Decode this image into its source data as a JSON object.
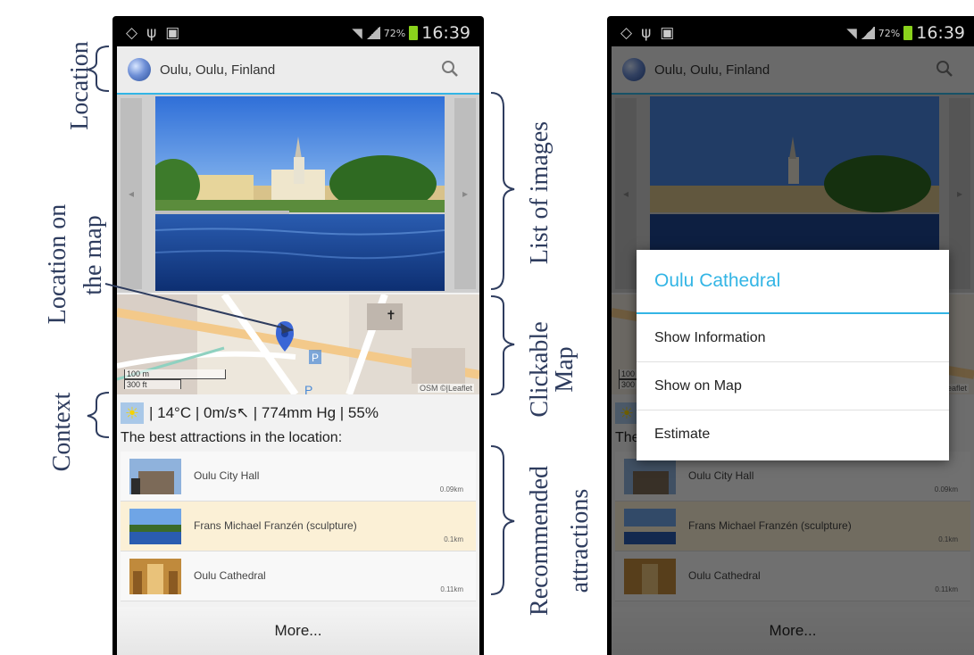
{
  "statusbar": {
    "battery_pct": "72%",
    "time": "16:39"
  },
  "appbar": {
    "location": "Oulu, Oulu, Finland"
  },
  "carousel": {
    "prev_glyph": "◂",
    "next_glyph": "▸"
  },
  "map": {
    "attribution": "OSM ©|Leaflet",
    "scale_m": "100 m",
    "scale_ft": "300 ft"
  },
  "context": {
    "weather": "| 14°C | 0m/s↖ | 774mm Hg | 55%"
  },
  "attractions": {
    "title": "The best attractions in the location:",
    "items": [
      {
        "name": "Oulu City Hall",
        "distance": "0.09km"
      },
      {
        "name": "Frans Michael Franzén (sculpture)",
        "distance": "0.1km"
      },
      {
        "name": "Oulu Cathedral",
        "distance": "0.11km"
      }
    ],
    "more_label": "More..."
  },
  "dialog": {
    "title": "Oulu Cathedral",
    "items": [
      "Show Information",
      "Show on Map",
      "Estimate"
    ]
  },
  "annotations": {
    "location": "Location",
    "location_on_map_1": "Location on",
    "location_on_map_2": "the map",
    "context": "Context",
    "list_of_images": "List of images",
    "clickable_map_1": "Clickable",
    "clickable_map_2": "Map",
    "recommended_1": "Recommended",
    "recommended_2": "attractions"
  },
  "colors": {
    "accent": "#33b5e5",
    "annotation": "#2e3c5e",
    "highlight_row": "#fbf0d6"
  }
}
